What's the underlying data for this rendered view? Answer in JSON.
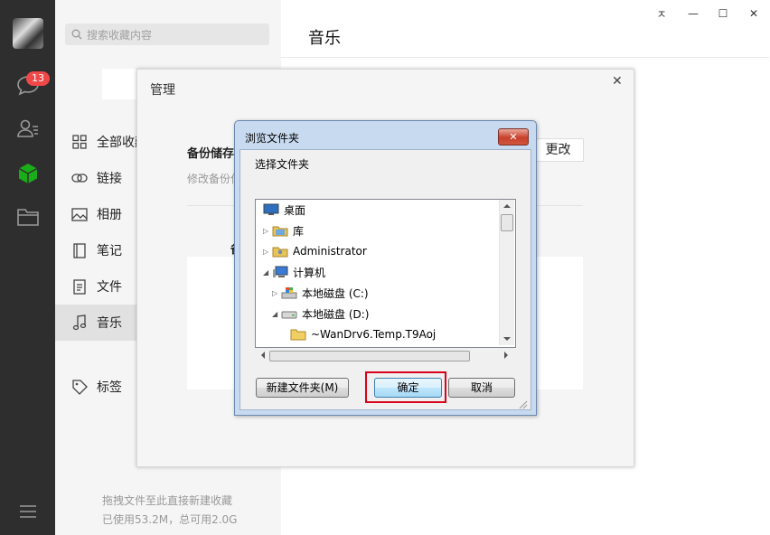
{
  "sidebar_nav": {
    "badge_count": "13",
    "icons": [
      "avatar",
      "chat-icon",
      "contacts-icon",
      "favorites-cube-icon",
      "folder-icon",
      "menu-icon"
    ]
  },
  "category_panel": {
    "search_placeholder": "搜索收藏内容",
    "items": [
      {
        "label": "全部收藏",
        "icon": "grid-icon"
      },
      {
        "label": "链接",
        "icon": "link-icon"
      },
      {
        "label": "相册",
        "icon": "image-icon"
      },
      {
        "label": "笔记",
        "icon": "note-icon"
      },
      {
        "label": "文件",
        "icon": "file-icon"
      },
      {
        "label": "音乐",
        "icon": "music-icon"
      },
      {
        "label": "标签",
        "icon": "tag-icon"
      }
    ],
    "active_item": "音乐",
    "footer_hint": "拖拽文件至此直接新建收藏",
    "footer_usage": "已使用53.2M，总可用2.0G"
  },
  "main": {
    "title": "音乐"
  },
  "window_controls": {
    "pin": "ㅈ",
    "minimize": "—",
    "maximize": "☐",
    "close": "✕"
  },
  "manage_dialog": {
    "title": "管理",
    "close": "✕",
    "backup_label": "备份储存",
    "backup_sub": "修改备份位",
    "change_button": "更改",
    "section_label": "备"
  },
  "browse_dialog": {
    "title": "浏览文件夹",
    "close": "✕",
    "subtitle": "选择文件夹",
    "tree": [
      {
        "label": "桌面",
        "icon": "desktop-icon",
        "toggle": ""
      },
      {
        "label": "库",
        "icon": "library-icon",
        "toggle": "▷"
      },
      {
        "label": "Administrator",
        "icon": "user-folder-icon",
        "toggle": "▷"
      },
      {
        "label": "计算机",
        "icon": "computer-icon",
        "toggle": "◢"
      },
      {
        "label": "本地磁盘 (C:)",
        "icon": "windows-drive-icon",
        "toggle": "▷"
      },
      {
        "label": "本地磁盘 (D:)",
        "icon": "drive-icon",
        "toggle": "◢"
      },
      {
        "label": "~WanDrv6.Temp.T9Aoj",
        "icon": "folder-icon",
        "toggle": ""
      }
    ],
    "new_folder_button": "新建文件夹(M)",
    "ok_button": "确定",
    "cancel_button": "取消",
    "highlight_color": "#d9001b"
  }
}
